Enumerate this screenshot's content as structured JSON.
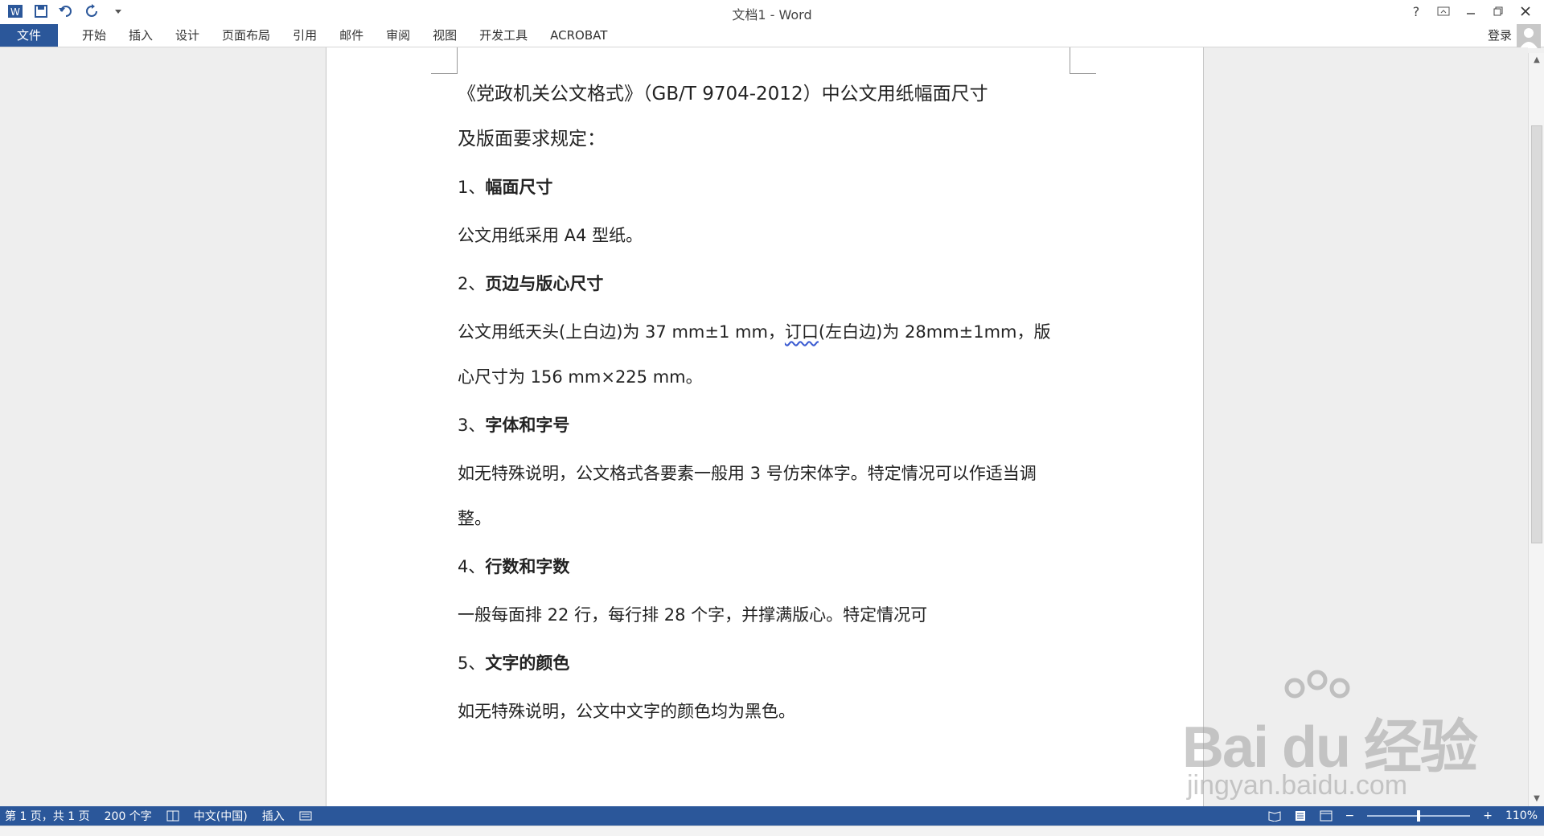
{
  "title_bar": {
    "document_title": "文档1 - Word",
    "help_label": "?",
    "qat_icons": [
      "word-logo-icon",
      "save-icon",
      "undo-icon",
      "redo-icon",
      "customize-qat-icon"
    ]
  },
  "ribbon": {
    "file_tab": "文件",
    "tabs": [
      "开始",
      "插入",
      "设计",
      "页面布局",
      "引用",
      "邮件",
      "审阅",
      "视图",
      "开发工具",
      "ACROBAT"
    ],
    "sign_in": "登录"
  },
  "document": {
    "title_line1": "《党政机关公文格式》（GB/T 9704-2012）中公文用纸幅面尺寸",
    "title_line2": "及版面要求规定：",
    "sections": [
      {
        "number": "1、",
        "heading": "幅面尺寸",
        "body": [
          "公文用纸采用 A4 型纸。"
        ]
      },
      {
        "number": "2、",
        "heading": "页边与版心尺寸",
        "body_parts": [
          "公文用纸天头(上白边)为 37 mm±1 mm，",
          "订口",
          "(左白边)为 28mm±1mm，版",
          "心尺寸为 156 mm×225 mm。"
        ]
      },
      {
        "number": "3、",
        "heading": "字体和字号",
        "body": [
          "如无特殊说明，公文格式各要素一般用 3 号仿宋体字。特定情况可以作适当调",
          "整。"
        ]
      },
      {
        "number": "4、",
        "heading": "行数和字数",
        "body": [
          "一般每面排 22 行，每行排 28 个字，并撑满版心。特定情况可"
        ]
      },
      {
        "number": "5、",
        "heading": "文字的颜色",
        "body": [
          "如无特殊说明，公文中文字的颜色均为黑色。"
        ]
      }
    ]
  },
  "status_bar": {
    "page_info": "第 1 页，共 1 页",
    "word_count": "200 个字",
    "language": "中文(中国)",
    "insert_mode": "插入",
    "zoom_percent": "110%",
    "zoom_level": 1.1
  },
  "watermark": {
    "main": "Bai du 经验",
    "sub": "jingyan.baidu.com"
  },
  "colors": {
    "accent": "#2b579a",
    "page": "#ffffff",
    "background": "#eeeeee"
  }
}
